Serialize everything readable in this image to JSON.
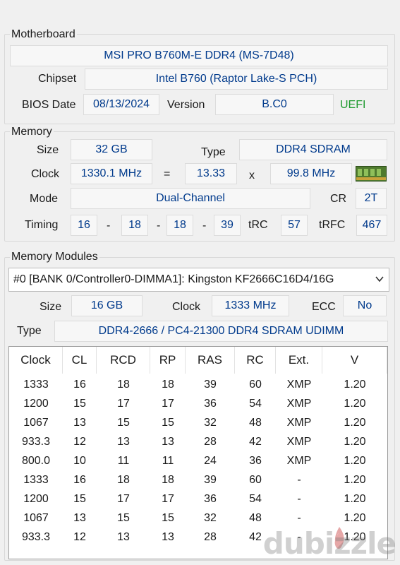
{
  "motherboard": {
    "label": "Motherboard",
    "name": "MSI PRO B760M-E DDR4 (MS-7D48)",
    "chipset_label": "Chipset",
    "chipset": "Intel B760 (Raptor Lake-S PCH)",
    "bios_date_label": "BIOS Date",
    "bios_date": "08/13/2024",
    "version_label": "Version",
    "version": "B.C0",
    "uefi": "UEFI"
  },
  "memory": {
    "label": "Memory",
    "size_label": "Size",
    "size": "32 GB",
    "type_label": "Type",
    "type": "DDR4 SDRAM",
    "clock_label": "Clock",
    "clock": "1330.1 MHz",
    "eq": "=",
    "multiplier": "13.33",
    "x": "x",
    "bus": "99.8 MHz",
    "mode_label": "Mode",
    "mode": "Dual-Channel",
    "cr_label": "CR",
    "cr": "2T",
    "timing_label": "Timing",
    "t1": "16",
    "t2": "18",
    "t3": "18",
    "t4": "39",
    "dash": "-",
    "trc_label": "tRC",
    "trc": "57",
    "trfc_label": "tRFC",
    "trfc": "467"
  },
  "modules": {
    "label": "Memory Modules",
    "selected": "#0 [BANK 0/Controller0-DIMMA1]: Kingston KF2666C16D4/16G",
    "size_label": "Size",
    "size": "16 GB",
    "clock_label": "Clock",
    "clock": "1333 MHz",
    "ecc_label": "ECC",
    "ecc": "No",
    "type_label": "Type",
    "type": "DDR4-2666 / PC4-21300 DDR4 SDRAM UDIMM",
    "table": {
      "headers": [
        "Clock",
        "CL",
        "RCD",
        "RP",
        "RAS",
        "RC",
        "Ext.",
        "V"
      ],
      "rows": [
        [
          "1333",
          "16",
          "18",
          "18",
          "39",
          "60",
          "XMP",
          "1.20"
        ],
        [
          "1200",
          "15",
          "17",
          "17",
          "36",
          "54",
          "XMP",
          "1.20"
        ],
        [
          "1067",
          "13",
          "15",
          "15",
          "32",
          "48",
          "XMP",
          "1.20"
        ],
        [
          "933.3",
          "12",
          "13",
          "13",
          "28",
          "42",
          "XMP",
          "1.20"
        ],
        [
          "800.0",
          "10",
          "11",
          "11",
          "24",
          "36",
          "XMP",
          "1.20"
        ],
        [
          "1333",
          "16",
          "18",
          "18",
          "39",
          "60",
          "-",
          "1.20"
        ],
        [
          "1200",
          "15",
          "17",
          "17",
          "36",
          "54",
          "-",
          "1.20"
        ],
        [
          "1067",
          "13",
          "15",
          "15",
          "32",
          "48",
          "-",
          "1.20"
        ],
        [
          "933.3",
          "12",
          "13",
          "13",
          "28",
          "42",
          "-",
          "1.20"
        ]
      ]
    }
  },
  "watermark": "dubizzle",
  "colors": {
    "value_text": "#003a8c",
    "uefi": "#1e9a2e",
    "background": "#f0f0f0"
  }
}
